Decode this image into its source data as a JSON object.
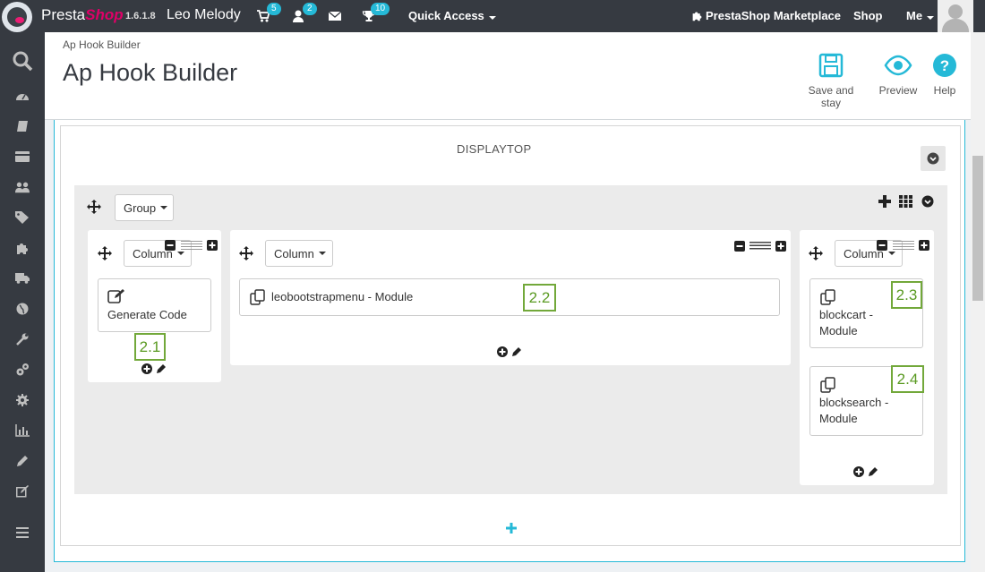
{
  "topbar": {
    "brand_main": "Presta",
    "brand_shop": "Shop",
    "version": "1.6.1.8",
    "shop_name": "Leo Melody",
    "orders_badge": "5",
    "customers_badge": "2",
    "trophy_badge": "10",
    "quick_access": "Quick Access",
    "marketplace": "PrestaShop Marketplace",
    "shop": "Shop",
    "me": "Me"
  },
  "header": {
    "breadcrumb": "Ap Hook Builder",
    "title": "Ap Hook Builder",
    "toolbar": {
      "save_label": "Save and stay",
      "preview_label": "Preview",
      "help_label": "Help"
    }
  },
  "hook": {
    "name": "DISPLAYTOP",
    "group_label": "Group",
    "columns": [
      {
        "label": "Column",
        "widgets": [
          {
            "text": "Generate Code",
            "callout": "2.1"
          }
        ]
      },
      {
        "label": "Column",
        "widgets": [
          {
            "text": "leobootstrapmenu - Module",
            "callout": "2.2"
          }
        ]
      },
      {
        "label": "Column",
        "widgets": [
          {
            "line1": "blockcart -",
            "line2": "Module",
            "callout": "2.3"
          },
          {
            "line1": "blocksearch -",
            "line2": "Module",
            "callout": "2.4"
          }
        ]
      }
    ]
  },
  "colors": {
    "accent": "#25b9d7",
    "brand_pink": "#df0067",
    "dark": "#363a41",
    "callout_green": "#72a83a"
  },
  "icons": {
    "sidebar": [
      "search-icon",
      "dashboard-icon",
      "orders-icon",
      "catalog-icon",
      "customers-icon",
      "price-rules-icon",
      "modules-icon",
      "shipping-icon",
      "localization-icon",
      "preferences-icon",
      "advanced-icon",
      "administration-icon",
      "stats-icon",
      "edit-icon",
      "design-icon",
      "menu-icon"
    ]
  }
}
